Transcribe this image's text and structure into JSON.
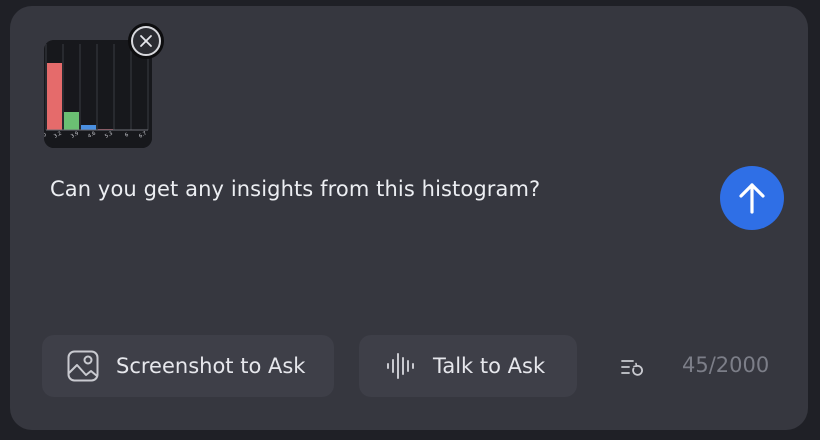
{
  "attachment": {
    "icon": "histogram-thumbnail",
    "tick_labels": [
      "0",
      "3.2",
      "3.9",
      "4.6",
      "5.3",
      "6",
      "6.7"
    ],
    "colors": {
      "bar1": "#e56b6b",
      "bar2": "#6bbf73",
      "bar3": "#4a8fe0",
      "bar4": "#a44a57"
    },
    "remove_icon": "close-icon"
  },
  "input": {
    "message": "Can you get any insights from this histogram?"
  },
  "send": {
    "icon": "arrow-up-icon",
    "color": "#2f6fe6"
  },
  "actions": {
    "screenshot_label": "Screenshot to Ask",
    "screenshot_icon": "image-icon",
    "talk_label": "Talk to Ask",
    "talk_icon": "waveform-icon",
    "history_icon": "history-list-icon"
  },
  "char_counter": "45/2000"
}
